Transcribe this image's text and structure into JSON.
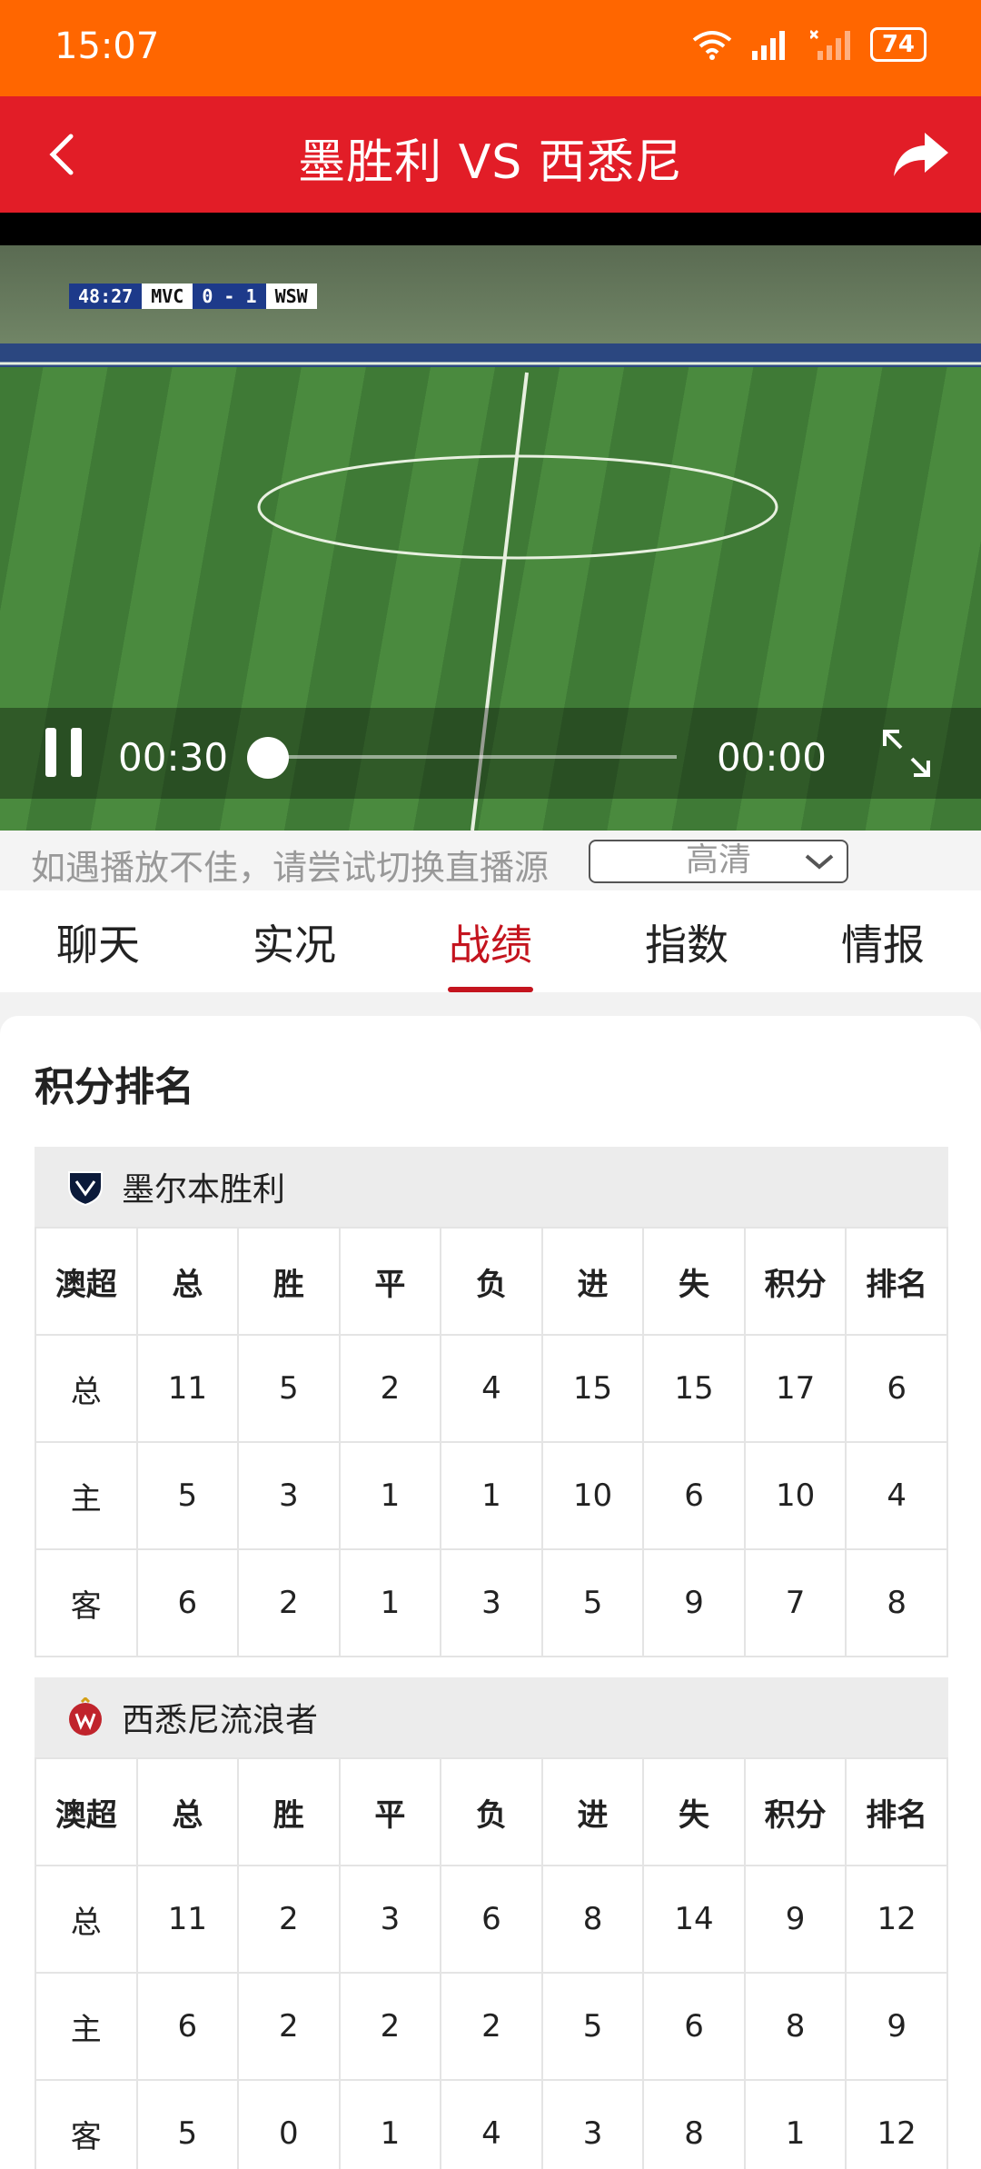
{
  "status_bar": {
    "time": "15:07",
    "battery": "74"
  },
  "header": {
    "title": "墨胜利 VS 西悉尼"
  },
  "video": {
    "scorebug": {
      "clock": "48:27",
      "home": "MVC",
      "score": "0 - 1",
      "away": "WSW"
    },
    "current_time": "00:30",
    "end_time": "00:00",
    "progress": 0.0
  },
  "source": {
    "hint": "如遇播放不佳，请尝试切换直播源",
    "quality": "高清"
  },
  "tabs": [
    {
      "label": "聊天"
    },
    {
      "label": "实况"
    },
    {
      "label": "战绩",
      "active": true
    },
    {
      "label": "指数"
    },
    {
      "label": "情报"
    }
  ],
  "standings": {
    "title": "积分排名",
    "columns": [
      "澳超",
      "总",
      "胜",
      "平",
      "负",
      "进",
      "失",
      "积分",
      "排名"
    ],
    "teams": [
      {
        "name": "墨尔本胜利",
        "rows": [
          [
            "总",
            "11",
            "5",
            "2",
            "4",
            "15",
            "15",
            "17",
            "6"
          ],
          [
            "主",
            "5",
            "3",
            "1",
            "1",
            "10",
            "6",
            "10",
            "4"
          ],
          [
            "客",
            "6",
            "2",
            "1",
            "3",
            "5",
            "9",
            "7",
            "8"
          ]
        ]
      },
      {
        "name": "西悉尼流浪者",
        "rows": [
          [
            "总",
            "11",
            "2",
            "3",
            "6",
            "8",
            "14",
            "9",
            "12"
          ],
          [
            "主",
            "6",
            "2",
            "2",
            "2",
            "5",
            "6",
            "8",
            "9"
          ],
          [
            "客",
            "5",
            "0",
            "1",
            "4",
            "3",
            "8",
            "1",
            "12"
          ]
        ]
      }
    ]
  },
  "colors": {
    "status_bar": "#ff6600",
    "header": "#e21d27",
    "accent": "#c4141e"
  }
}
